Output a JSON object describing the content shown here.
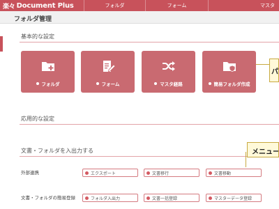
{
  "app": {
    "logo_jp": "楽々",
    "logo_en": "Document Plus"
  },
  "nav": [
    {
      "label": "フォルダ"
    },
    {
      "label": "フォーム"
    },
    {
      "label": "マスタ"
    }
  ],
  "page": {
    "title": "フォルダ管理"
  },
  "sections": {
    "basic": "基本的な設定",
    "applied": "応用的な設定",
    "io": "文書・フォルダを入出力する"
  },
  "tiles": [
    {
      "label": "フォルダ",
      "icon": "folder-add-icon"
    },
    {
      "label": "フォーム",
      "icon": "form-edit-icon"
    },
    {
      "label": "マスタ経路",
      "icon": "shuffle-icon"
    },
    {
      "label": "簡易フォルダ作成",
      "icon": "folder-shield-icon"
    }
  ],
  "callouts": {
    "top": "パ",
    "menu": "メニュー"
  },
  "io_rows": [
    {
      "label": "外部連携",
      "items": [
        "エクスポート",
        "文書移行",
        "文書移動"
      ]
    },
    {
      "label": "文書・フォルダの簡易登録",
      "items": [
        "フォルダ入出力",
        "文書一括登録",
        "マスターデータ登録"
      ]
    }
  ],
  "colors": {
    "brand": "#c8525b",
    "tile": "#c96a71",
    "callout_bg": "#fff9d9",
    "callout_border": "#c8a940"
  }
}
